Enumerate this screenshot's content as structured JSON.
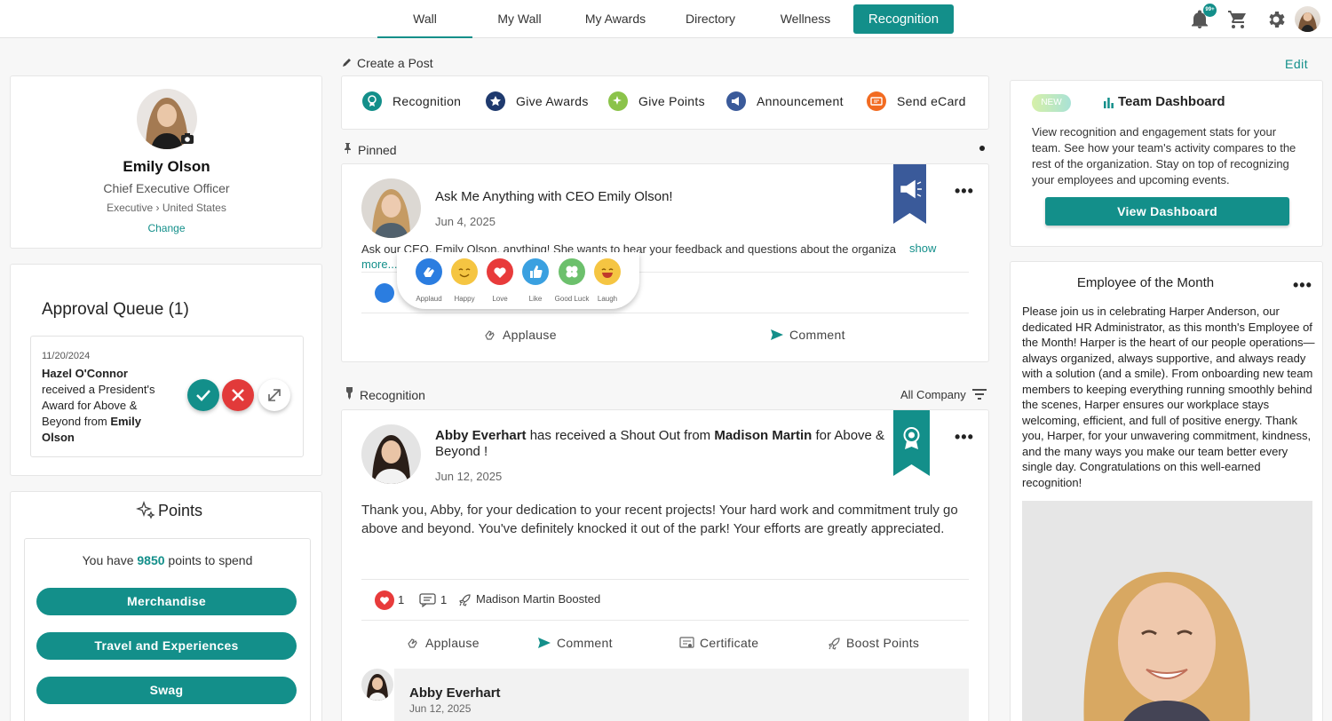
{
  "nav": {
    "tabs": [
      "Wall",
      "My Wall",
      "My Awards",
      "Directory",
      "Wellness",
      "Recognition"
    ],
    "active": "Wall",
    "notification_badge": "99+",
    "accent": "#138f8a"
  },
  "profile": {
    "name": "Emily Olson",
    "title": "Chief Executive Officer",
    "location": "Executive › United States",
    "change_label": "Change"
  },
  "approval_queue": {
    "title": "Approval Queue (1)",
    "item": {
      "date": "11/20/2024",
      "recipient": "Hazel O'Connor",
      "text": "received a President's Award for Above & Beyond from",
      "from": "Emily Olson"
    }
  },
  "points": {
    "title": "Points",
    "prefix": "You have",
    "amount": "9850",
    "suffix": "points to spend",
    "buttons": [
      "Merchandise",
      "Travel and Experiences",
      "Swag"
    ]
  },
  "create_post": {
    "label": "Create a Post",
    "types": [
      {
        "label": "Recognition",
        "icon": "ribbon-icon",
        "color": "#138f8a"
      },
      {
        "label": "Give Awards",
        "icon": "star-icon",
        "color": "#1f3a6e"
      },
      {
        "label": "Give Points",
        "icon": "sparkle-icon",
        "color": "#8bc34a"
      },
      {
        "label": "Announcement",
        "icon": "megaphone-icon",
        "color": "#3a5a9a"
      },
      {
        "label": "Send eCard",
        "icon": "ecard-icon",
        "color": "#f26b21"
      }
    ]
  },
  "pinned": {
    "section_label": "Pinned",
    "title": "Ask Me Anything with CEO Emily Olson!",
    "date": "Jun 4, 2025",
    "body": "Ask our CEO, Emily Olson, anything! She wants to hear your feedback and questions about the organiza",
    "show_more": "show more...",
    "reactions": [
      "Applaud",
      "Happy",
      "Love",
      "Like",
      "Good Luck",
      "Laugh"
    ],
    "actions": [
      "Applause",
      "Comment"
    ]
  },
  "recognition": {
    "section_label": "Recognition",
    "filter_label": "All Company",
    "recipient": "Abby Everhart",
    "middle": "has received a Shout Out from",
    "giver": "Madison Martin",
    "award": "for Above & Beyond !",
    "date": "Jun 12, 2025",
    "body": "Thank you, Abby, for your dedication to your recent projects! Your hard work and commitment truly go above and beyond. You've definitely knocked it out of the park! Your efforts are greatly appreciated.",
    "love_count": "1",
    "comment_count": "1",
    "boosted": "Madison Martin Boosted",
    "actions": [
      "Applause",
      "Comment",
      "Certificate",
      "Boost Points"
    ],
    "comment": {
      "author": "Abby Everhart",
      "date": "Jun 12, 2025"
    }
  },
  "right": {
    "edit_label": "Edit",
    "dashboard": {
      "badge": "NEW",
      "title": "Team Dashboard",
      "text": "View recognition and engagement stats for your team. See how your team's activity compares to the rest of the organization. Stay on top of recognizing your employees and upcoming events.",
      "button": "View Dashboard"
    },
    "eotm": {
      "title": "Employee of the Month",
      "text": "Please join us in celebrating Harper Anderson, our dedicated HR Administrator, as this month's Employee of the Month! Harper is the heart of our people operations—always organized, always supportive, and always ready with a solution (and a smile). From onboarding new team members to keeping everything running smoothly behind the scenes, Harper ensures our workplace stays welcoming, efficient, and full of positive energy. Thank you, Harper, for your unwavering commitment, kindness, and the many ways you make our team better every single day. Congratulations on this well-earned recognition!"
    }
  }
}
